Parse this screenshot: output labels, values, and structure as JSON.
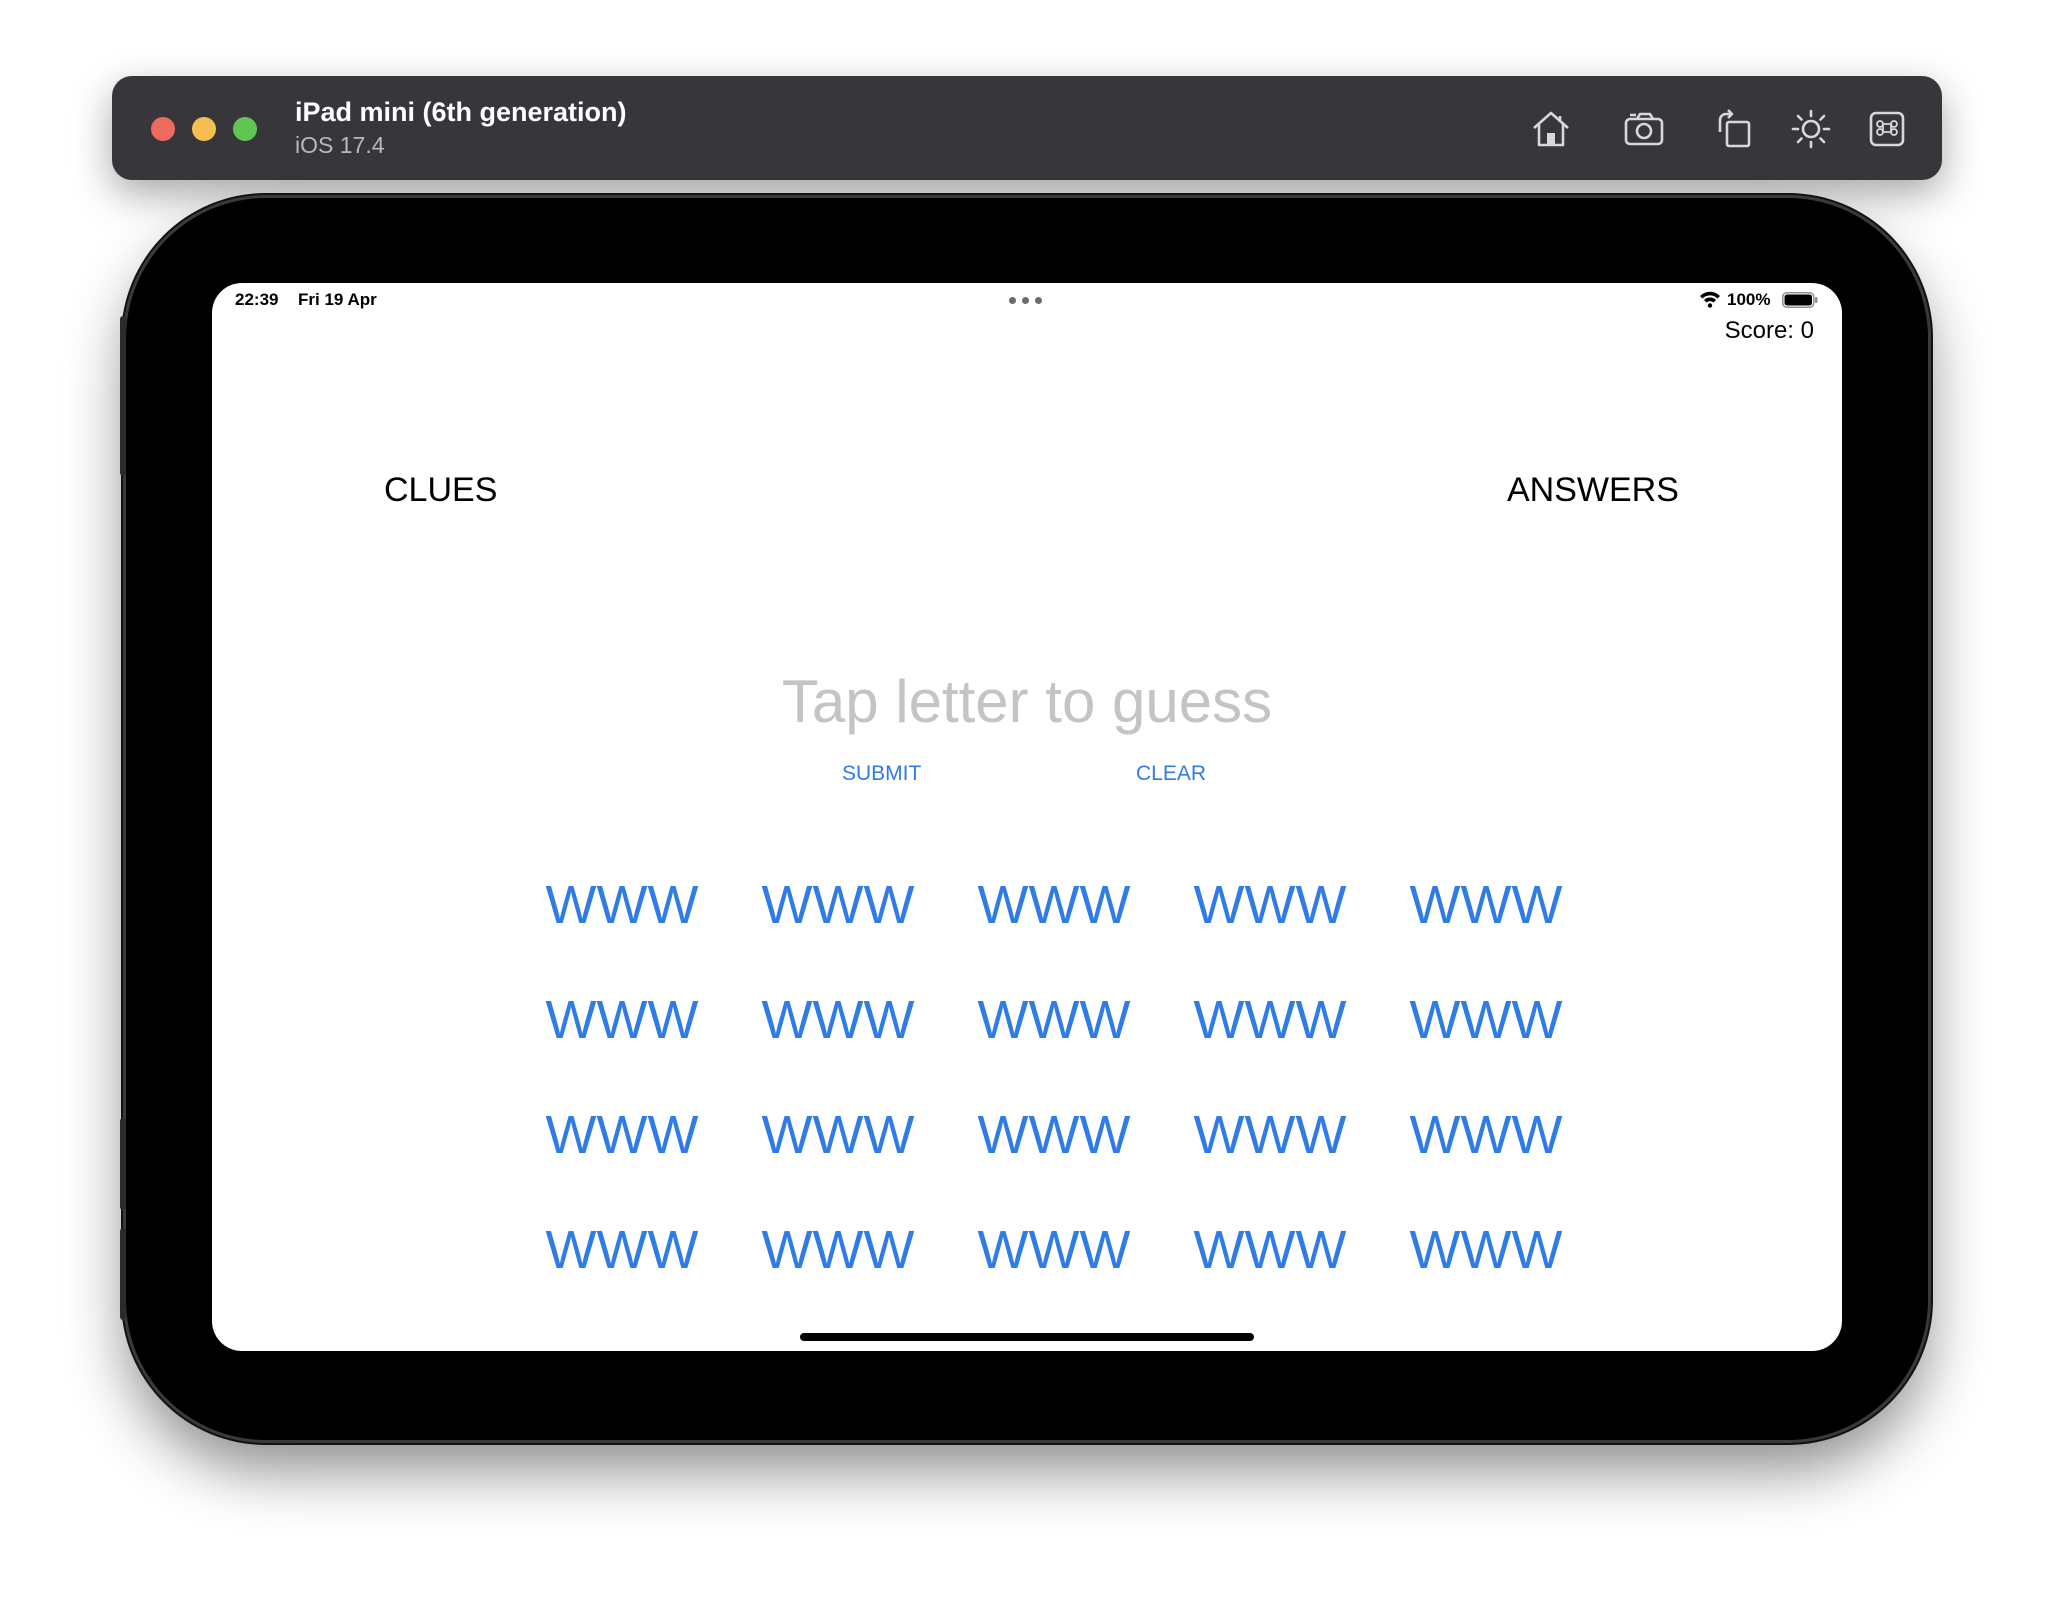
{
  "simulator": {
    "device_name": "iPad mini (6th generation)",
    "os_version": "iOS 17.4",
    "toolbar_icons": [
      "home-icon",
      "screenshot-icon",
      "rotate-icon",
      "appearance-icon",
      "command-icon"
    ]
  },
  "status_bar": {
    "time": "22:39",
    "date": "Fri 19 Apr",
    "battery": "100%"
  },
  "game": {
    "score": "Score: 0",
    "clues_label": "CLUES",
    "answers_label": "ANSWERS",
    "current_answer_placeholder": "Tap letter to guess",
    "submit_label": "SUBMIT",
    "clear_label": "CLEAR",
    "letter_buttons": [
      "WWW",
      "WWW",
      "WWW",
      "WWW",
      "WWW",
      "WWW",
      "WWW",
      "WWW",
      "WWW",
      "WWW",
      "WWW",
      "WWW",
      "WWW",
      "WWW",
      "WWW",
      "WWW",
      "WWW",
      "WWW",
      "WWW",
      "WWW"
    ]
  },
  "colors": {
    "accent": "#2f7ce6",
    "placeholder": "#c4c4c6",
    "titlebar": "#37363b"
  }
}
